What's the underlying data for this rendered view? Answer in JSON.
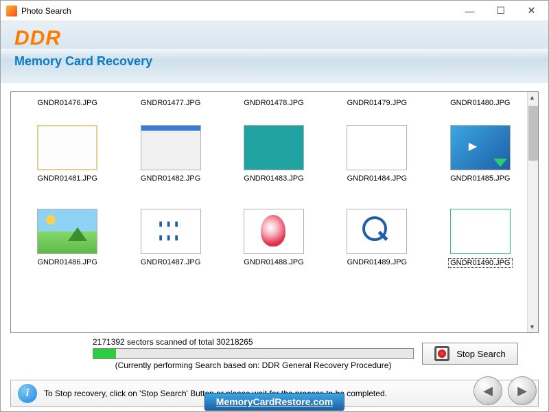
{
  "window": {
    "title": "Photo Search",
    "minimize": "—",
    "maximize": "☐",
    "close": "✕"
  },
  "header": {
    "logo": "DDR",
    "subtitle": "Memory Card Recovery"
  },
  "results": {
    "row0": [
      {
        "label": "GNDR01476.JPG"
      },
      {
        "label": "GNDR01477.JPG"
      },
      {
        "label": "GNDR01478.JPG"
      },
      {
        "label": "GNDR01479.JPG"
      },
      {
        "label": "GNDR01480.JPG"
      }
    ],
    "row1": [
      {
        "label": "GNDR01481.JPG"
      },
      {
        "label": "GNDR01482.JPG"
      },
      {
        "label": "GNDR01483.JPG"
      },
      {
        "label": "GNDR01484.JPG"
      },
      {
        "label": "GNDR01485.JPG"
      }
    ],
    "row2": [
      {
        "label": "GNDR01486.JPG"
      },
      {
        "label": "GNDR01487.JPG"
      },
      {
        "label": "GNDR01488.JPG"
      },
      {
        "label": "GNDR01489.JPG"
      },
      {
        "label": "GNDR01490.JPG",
        "selected": true
      }
    ]
  },
  "progress": {
    "status": "2171392 sectors scanned of total 30218265",
    "percent": 7,
    "procedure": "(Currently performing Search based on:  DDR General Recovery Procedure)",
    "stop_label": "Stop Search"
  },
  "help": {
    "text": "To Stop recovery, click on 'Stop Search' Button or please wait for the process to be completed."
  },
  "nav": {
    "back": "◀",
    "next": "▶"
  },
  "footer": {
    "link": "MemoryCardRestore.com"
  }
}
